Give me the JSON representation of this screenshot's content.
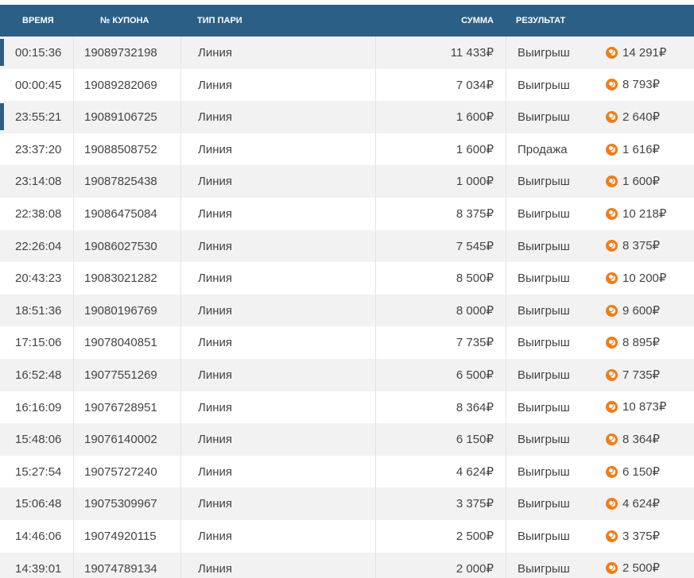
{
  "colors": {
    "header_bg": "#2b5f86",
    "row_odd": "#f2f2f2",
    "row_even": "#ffffff",
    "coin": "#f07d1a",
    "marker": "#2b5f86"
  },
  "table": {
    "headers": {
      "time": "ВРЕМЯ",
      "coupon": "№ КУПОНА",
      "type": "ТИП ПАРИ",
      "sum": "СУММА",
      "result": "РЕЗУЛЬТАТ"
    },
    "rows": [
      {
        "time": "00:15:36",
        "coupon": "19089732198",
        "type": "Линия",
        "sum": "11 433₽",
        "result": "Выигрыш",
        "payout": "14 291₽",
        "marked": true
      },
      {
        "time": "00:00:45",
        "coupon": "19089282069",
        "type": "Линия",
        "sum": "7 034₽",
        "result": "Выигрыш",
        "payout": "8 793₽",
        "marked": false
      },
      {
        "time": "23:55:21",
        "coupon": "19089106725",
        "type": "Линия",
        "sum": "1 600₽",
        "result": "Выигрыш",
        "payout": "2 640₽",
        "marked": true
      },
      {
        "time": "23:37:20",
        "coupon": "19088508752",
        "type": "Линия",
        "sum": "1 600₽",
        "result": "Продажа",
        "payout": "1 616₽",
        "marked": false
      },
      {
        "time": "23:14:08",
        "coupon": "19087825438",
        "type": "Линия",
        "sum": "1 000₽",
        "result": "Выигрыш",
        "payout": "1 600₽",
        "marked": false
      },
      {
        "time": "22:38:08",
        "coupon": "19086475084",
        "type": "Линия",
        "sum": "8 375₽",
        "result": "Выигрыш",
        "payout": "10 218₽",
        "marked": false
      },
      {
        "time": "22:26:04",
        "coupon": "19086027530",
        "type": "Линия",
        "sum": "7 545₽",
        "result": "Выигрыш",
        "payout": "8 375₽",
        "marked": false
      },
      {
        "time": "20:43:23",
        "coupon": "19083021282",
        "type": "Линия",
        "sum": "8 500₽",
        "result": "Выигрыш",
        "payout": "10 200₽",
        "marked": false
      },
      {
        "time": "18:51:36",
        "coupon": "19080196769",
        "type": "Линия",
        "sum": "8 000₽",
        "result": "Выигрыш",
        "payout": "9 600₽",
        "marked": false
      },
      {
        "time": "17:15:06",
        "coupon": "19078040851",
        "type": "Линия",
        "sum": "7 735₽",
        "result": "Выигрыш",
        "payout": "8 895₽",
        "marked": false
      },
      {
        "time": "16:52:48",
        "coupon": "19077551269",
        "type": "Линия",
        "sum": "6 500₽",
        "result": "Выигрыш",
        "payout": "7 735₽",
        "marked": false
      },
      {
        "time": "16:16:09",
        "coupon": "19076728951",
        "type": "Линия",
        "sum": "8 364₽",
        "result": "Выигрыш",
        "payout": "10 873₽",
        "marked": false
      },
      {
        "time": "15:48:06",
        "coupon": "19076140002",
        "type": "Линия",
        "sum": "6 150₽",
        "result": "Выигрыш",
        "payout": "8 364₽",
        "marked": false
      },
      {
        "time": "15:27:54",
        "coupon": "19075727240",
        "type": "Линия",
        "sum": "4 624₽",
        "result": "Выигрыш",
        "payout": "6 150₽",
        "marked": false
      },
      {
        "time": "15:06:48",
        "coupon": "19075309967",
        "type": "Линия",
        "sum": "3 375₽",
        "result": "Выигрыш",
        "payout": "4 624₽",
        "marked": false
      },
      {
        "time": "14:46:06",
        "coupon": "19074920115",
        "type": "Линия",
        "sum": "2 500₽",
        "result": "Выигрыш",
        "payout": "3 375₽",
        "marked": false
      },
      {
        "time": "14:39:01",
        "coupon": "19074789134",
        "type": "Линия",
        "sum": "2 000₽",
        "result": "Выигрыш",
        "payout": "2 500₽",
        "marked": false
      }
    ]
  }
}
